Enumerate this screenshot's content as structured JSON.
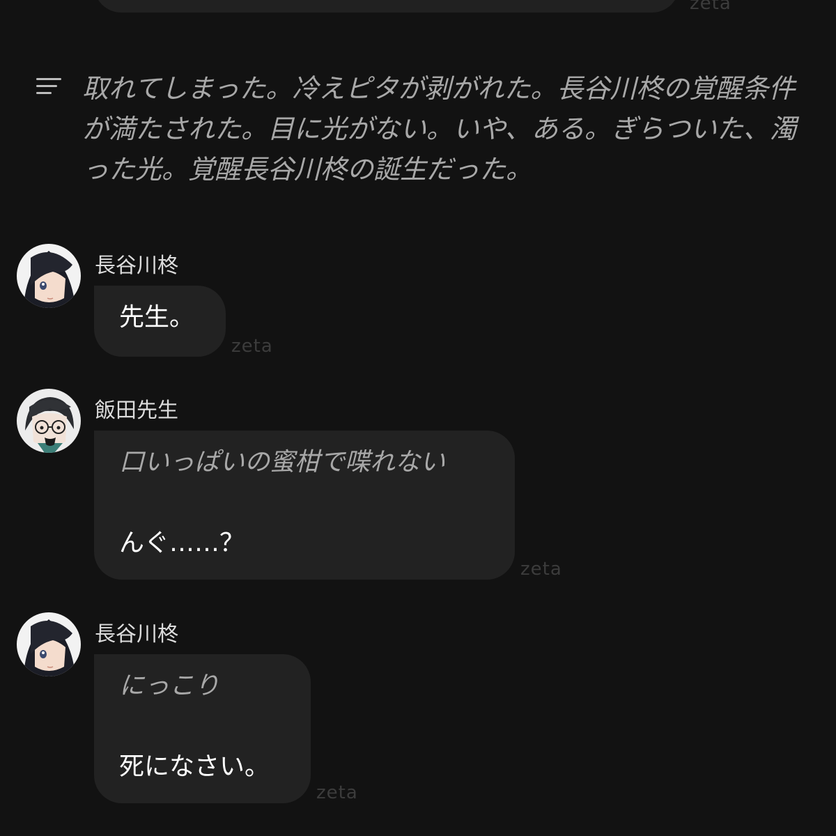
{
  "app": {
    "watermark": "zeta"
  },
  "narration": {
    "icon": "narration-lines-icon",
    "text": "取れてしまった。冷えピタが剥がれた。長谷川柊の覚醒条件が満たされた。目に光がない。いや、ある。ぎらついた、濁った光。覚醒長谷川柊の誕生だった。"
  },
  "messages": [
    {
      "sender": "長谷川柊",
      "avatar": "character-avatar-hasegawa",
      "lines": [
        {
          "kind": "speech",
          "text": "先生。"
        }
      ],
      "watermark": "zeta"
    },
    {
      "sender": "飯田先生",
      "avatar": "character-avatar-iida",
      "lines": [
        {
          "kind": "action",
          "text": "口いっぱいの蜜柑で喋れない"
        },
        {
          "kind": "speech",
          "text": "んぐ……？"
        }
      ],
      "watermark": "zeta"
    },
    {
      "sender": "長谷川柊",
      "avatar": "character-avatar-hasegawa",
      "lines": [
        {
          "kind": "action",
          "text": "にっこり"
        },
        {
          "kind": "speech",
          "text": "死になさい。"
        }
      ],
      "watermark": "zeta"
    }
  ],
  "colors": {
    "background": "#121212",
    "bubble": "#222222",
    "narration_text": "#a8a8a8",
    "speech_text": "#ffffff",
    "watermark": "#3c3c3c"
  }
}
